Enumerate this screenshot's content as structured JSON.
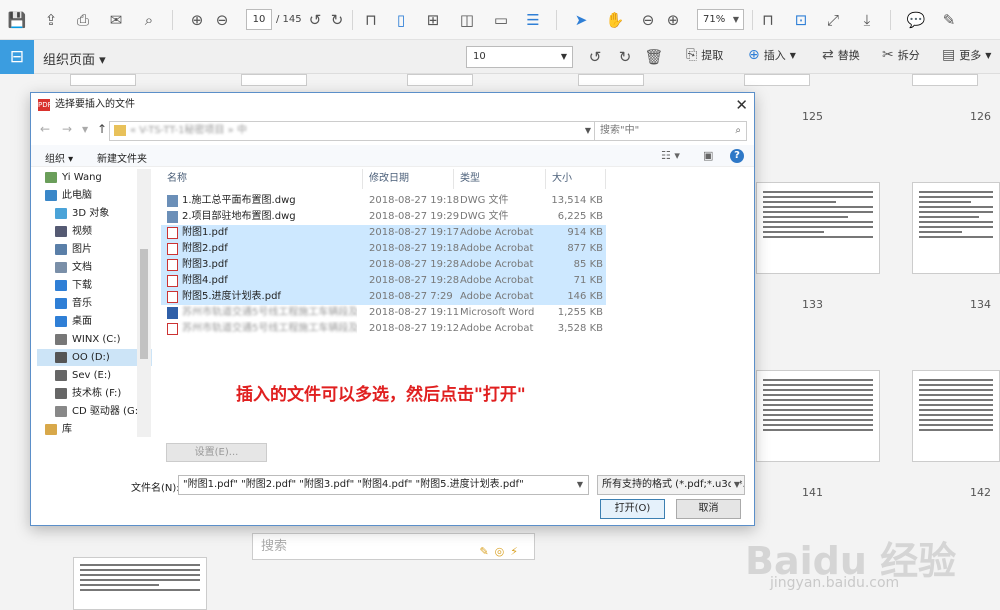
{
  "toolbar": {
    "page_current": "10",
    "page_total": "/ 145",
    "zoom": "71%"
  },
  "toolbar2": {
    "organize_label": "组织页面 ▾",
    "page_select": "10",
    "extract": "提取",
    "insert": "插入",
    "replace": "替换",
    "split": "拆分",
    "more": "更多"
  },
  "thumbnails": {
    "n125": "125",
    "n126": "126",
    "n133": "133",
    "n134": "134",
    "n141": "141",
    "n142": "142"
  },
  "dialog": {
    "title": "选择要插入的文件",
    "address": "« V-TS-TT-1秘密项目 » 中",
    "search_placeholder": "搜索\"中\"",
    "organize": "组织 ▾",
    "new_folder": "新建文件夹",
    "tree": [
      {
        "label": "Yi Wang",
        "color": "#6a9e5a"
      },
      {
        "label": "此电脑",
        "color": "#3a87c8"
      },
      {
        "label": "3D 对象",
        "color": "#4aa3d8"
      },
      {
        "label": "视频",
        "color": "#555a73"
      },
      {
        "label": "图片",
        "color": "#5a7fa8"
      },
      {
        "label": "文档",
        "color": "#7a8fa8"
      },
      {
        "label": "下载",
        "color": "#2f7fd6"
      },
      {
        "label": "音乐",
        "color": "#2f7fd6"
      },
      {
        "label": "桌面",
        "color": "#2f7fd6"
      },
      {
        "label": "WINX (C:)",
        "color": "#777"
      },
      {
        "label": "OO (D:)",
        "color": "#555"
      },
      {
        "label": "Sev (E:)",
        "color": "#666"
      },
      {
        "label": "技术栋 (F:)",
        "color": "#666"
      },
      {
        "label": "CD 驱动器 (G:",
        "color": "#888"
      },
      {
        "label": "库",
        "color": "#d8a84a"
      }
    ],
    "columns": {
      "name": "名称",
      "date": "修改日期",
      "type": "类型",
      "size": "大小"
    },
    "files": [
      {
        "name": "1.施工总平面布置图.dwg",
        "date": "2018-08-27 19:18",
        "type": "DWG 文件",
        "size": "13,514 KB",
        "icon": "dwg"
      },
      {
        "name": "2.项目部驻地布置图.dwg",
        "date": "2018-08-27 19:29",
        "type": "DWG 文件",
        "size": "6,225 KB",
        "icon": "dwg"
      },
      {
        "name": "附图1.pdf",
        "date": "2018-08-27 19:17",
        "type": "Adobe Acrobat",
        "size": "914 KB",
        "icon": "pdf"
      },
      {
        "name": "附图2.pdf",
        "date": "2018-08-27 19:18",
        "type": "Adobe Acrobat",
        "size": "877 KB",
        "icon": "pdf"
      },
      {
        "name": "附图3.pdf",
        "date": "2018-08-27 19:28",
        "type": "Adobe Acrobat",
        "size": "85 KB",
        "icon": "pdf"
      },
      {
        "name": "附图4.pdf",
        "date": "2018-08-27 19:28",
        "type": "Adobe Acrobat",
        "size": "71 KB",
        "icon": "pdf"
      },
      {
        "name": "附图5.进度计划表.pdf",
        "date": "2018-08-27 7:29",
        "type": "Adobe Acrobat",
        "size": "146 KB",
        "icon": "pdf"
      },
      {
        "name": "苏州市轨道交通5号线工程施工车辆段及...",
        "date": "2018-08-27 19:11",
        "type": "Microsoft Word",
        "size": "1,255 KB",
        "icon": "doc"
      },
      {
        "name": "苏州市轨道交通5号线工程施工车辆段及...",
        "date": "2018-08-27 19:12",
        "type": "Adobe Acrobat",
        "size": "3,528 KB",
        "icon": "pdf"
      }
    ],
    "annotation": "插入的文件可以多选，然后点击\"打开\"",
    "settings_btn": "设置(E)...",
    "filename_label": "文件名(N):",
    "filename_value": "\"附图1.pdf\" \"附图2.pdf\" \"附图3.pdf\" \"附图4.pdf\" \"附图5.进度计划表.pdf\"",
    "filetype": "所有支持的格式 (*.pdf;*.u3d;*.",
    "open_btn": "打开(O)",
    "cancel_btn": "取消"
  },
  "bottom_search": "搜索",
  "watermark": {
    "main": "Baidu 经验",
    "sub": "jingyan.baidu.com"
  }
}
